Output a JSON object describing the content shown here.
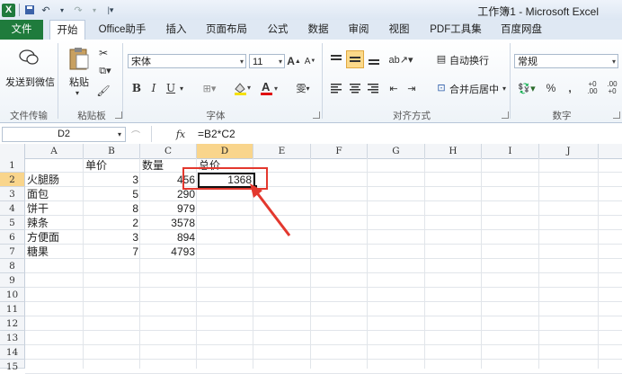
{
  "titlebar": {
    "logo": "X",
    "window_title": "工作簿1 - Microsoft Excel",
    "quick_access": [
      "save-icon",
      "undo-icon",
      "redo-icon",
      "customize-icon"
    ]
  },
  "tabs": [
    "文件",
    "开始",
    "Office助手",
    "插入",
    "页面布局",
    "公式",
    "数据",
    "审阅",
    "视图",
    "PDF工具集",
    "百度网盘"
  ],
  "ribbon": {
    "wechat_label": "发送到微信",
    "file_transfer_label": "文件传输",
    "paste_label": "粘贴板",
    "paste_button": "粘贴",
    "font_name": "宋体",
    "font_size": "11",
    "bold": "B",
    "italic": "I",
    "underline": "U",
    "font_color_glyph": "A",
    "wen_glyph": "雯",
    "font_group": "字体",
    "wrap_text": "自动换行",
    "merge_center": "合并后居中",
    "alignment_group": "对齐方式",
    "number_format": "常规",
    "percent": "%",
    "comma": ",",
    "inc_decimal": "+0 .00",
    "dec_decimal": ".00 +0",
    "number_group": "数字",
    "grow_font": "A",
    "shrink_font": "A"
  },
  "formula_bar": {
    "name_box": "D2",
    "fx": "fx",
    "formula": "=B2*C2"
  },
  "columns": [
    "A",
    "B",
    "C",
    "D",
    "E",
    "F",
    "G",
    "H",
    "I",
    "J"
  ],
  "rows": [
    "1",
    "2",
    "3",
    "4",
    "5",
    "6",
    "7",
    "8",
    "9",
    "10",
    "11",
    "12",
    "13",
    "14",
    "15"
  ],
  "headers": {
    "b": "单价",
    "c": "数量",
    "d": "总价"
  },
  "data_rows": [
    {
      "name": "火腿肠",
      "price": "3",
      "qty": "456",
      "total": "1368"
    },
    {
      "name": "面包",
      "price": "5",
      "qty": "290",
      "total": ""
    },
    {
      "name": "饼干",
      "price": "8",
      "qty": "979",
      "total": ""
    },
    {
      "name": "辣条",
      "price": "2",
      "qty": "3578",
      "total": ""
    },
    {
      "name": "方便面",
      "price": "3",
      "qty": "894",
      "total": ""
    },
    {
      "name": "糖果",
      "price": "7",
      "qty": "4793",
      "total": ""
    }
  ],
  "selected_cell": "D2",
  "colors": {
    "file_tab": "#1f7b3c",
    "selection_header": "#f9d58c",
    "annotation": "#e3382e"
  }
}
